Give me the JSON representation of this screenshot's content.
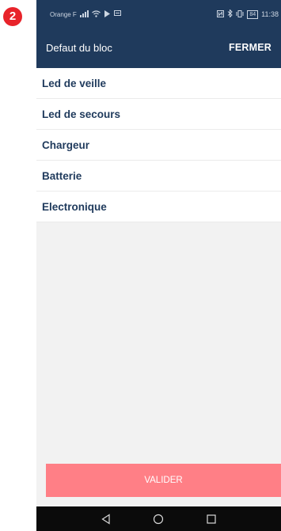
{
  "step_badge": "2",
  "status_bar": {
    "carrier": "Orange F",
    "battery": "84",
    "time": "11:38"
  },
  "app_bar": {
    "title": "Defaut du bloc",
    "action_label": "FERMER"
  },
  "defects": [
    {
      "label": "Led de veille"
    },
    {
      "label": "Led de secours"
    },
    {
      "label": "Chargeur"
    },
    {
      "label": "Batterie"
    },
    {
      "label": "Electronique"
    }
  ],
  "footer": {
    "validate_label": "VALIDER"
  },
  "colors": {
    "primary": "#1f3a5c",
    "validate_button": "#ff7f86",
    "badge": "#e8232a"
  },
  "nav_bar": {
    "buttons": [
      "back-icon",
      "home-icon",
      "recents-icon"
    ]
  }
}
